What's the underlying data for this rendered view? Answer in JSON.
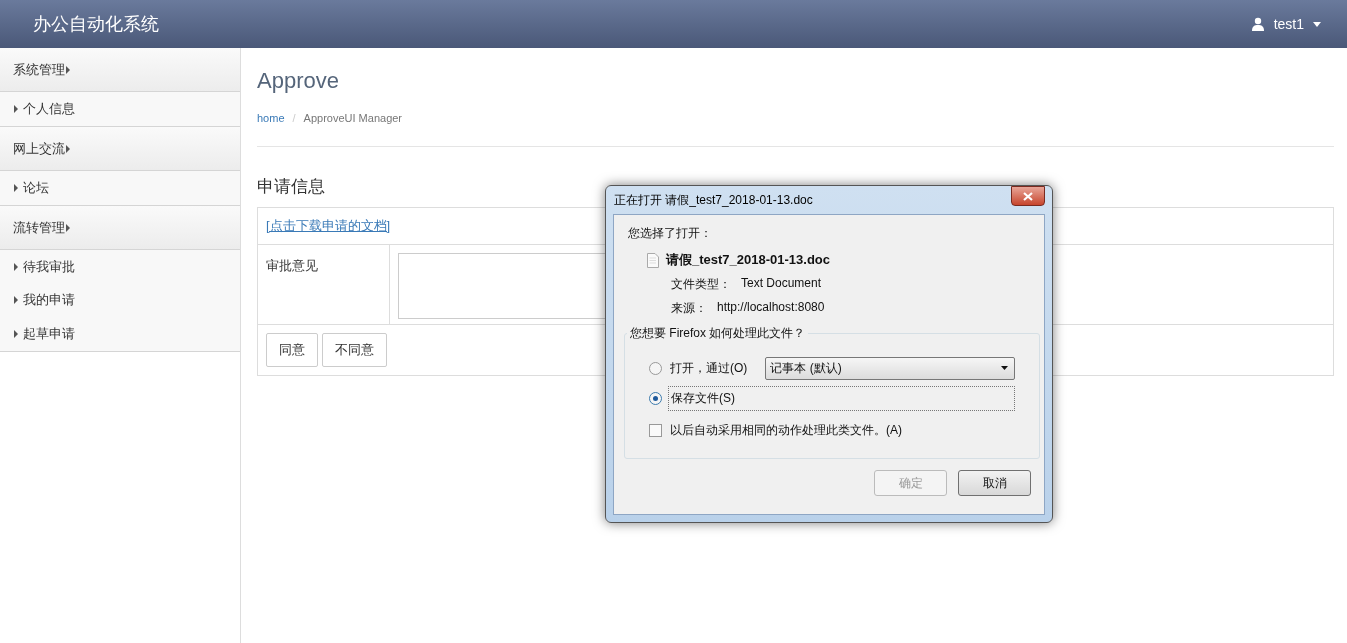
{
  "header": {
    "brand": "办公自动化系统",
    "user": "test1"
  },
  "sidebar": [
    {
      "kind": "group",
      "label": "系统管理"
    },
    {
      "kind": "item",
      "label": "个人信息"
    },
    {
      "kind": "group",
      "label": "网上交流"
    },
    {
      "kind": "item",
      "label": "论坛"
    },
    {
      "kind": "group",
      "label": "流转管理"
    },
    {
      "kind": "item",
      "label": "待我审批"
    },
    {
      "kind": "item",
      "label": "我的申请"
    },
    {
      "kind": "item",
      "label": "起草申请"
    }
  ],
  "page": {
    "title": "Approve",
    "breadcrumb": [
      "home",
      "ApproveUI Manager"
    ],
    "breadcrumb_separator": "/",
    "section": "申请信息",
    "download_link": "[点击下载申请的文档]",
    "opinion_label": "审批意见",
    "buttons": [
      "同意",
      "不同意"
    ]
  },
  "dialog": {
    "title": "正在打开 请假_test7_2018-01-13.doc",
    "intro": "您选择了打开：",
    "file_name": "请假_test7_2018-01-13.doc",
    "details": [
      {
        "label": "文件类型：",
        "value": "Text Document"
      },
      {
        "label": "来源：",
        "value": "http://localhost:8080"
      }
    ],
    "question": "您想要 Firefox 如何处理此文件？",
    "options": [
      {
        "label": "打开，通过(O)",
        "selected": false,
        "app": "记事本 (默认)"
      },
      {
        "label": "保存文件(S)",
        "selected": true
      }
    ],
    "remember": {
      "label": "以后自动采用相同的动作处理此类文件。(A)",
      "checked": false
    },
    "buttons": [
      {
        "label": "确定",
        "disabled": true
      },
      {
        "label": "取消",
        "disabled": false
      }
    ]
  }
}
